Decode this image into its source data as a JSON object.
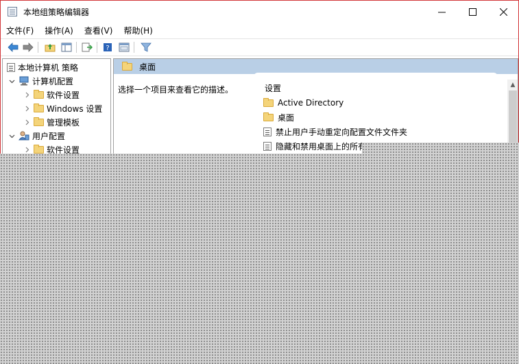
{
  "window": {
    "title": "本地组策略编辑器",
    "icon": "policy-editor-icon"
  },
  "menu": [
    {
      "label": "文件(F)"
    },
    {
      "label": "操作(A)"
    },
    {
      "label": "查看(V)"
    },
    {
      "label": "帮助(H)"
    }
  ],
  "toolbar_icons": [
    "back-arrow-icon",
    "forward-arrow-icon",
    "up-folder-icon",
    "show-hide-tree-icon",
    "export-list-icon",
    "help-icon",
    "properties-icon",
    "filter-icon"
  ],
  "tree": {
    "root": "本地计算机 策略",
    "computer_config": "计算机配置",
    "computer_children": [
      "软件设置",
      "Windows 设置",
      "管理模板"
    ],
    "user_config": "用户配置",
    "user_children": [
      "软件设置"
    ]
  },
  "right": {
    "header_title": "桌面",
    "description": "选择一个项目来查看它的描述。",
    "column_header": "设置",
    "items": [
      {
        "type": "folder",
        "label": "Active Directory"
      },
      {
        "type": "folder",
        "label": "桌面"
      },
      {
        "type": "policy",
        "label": "禁止用户手动重定向配置文件文件夹"
      },
      {
        "type": "policy",
        "label": "隐藏和禁用桌面上的所有项目"
      }
    ]
  },
  "colors": {
    "header_bg": "#b9cfe6",
    "folder": "#f4d47a",
    "window_border": "#d13438"
  }
}
